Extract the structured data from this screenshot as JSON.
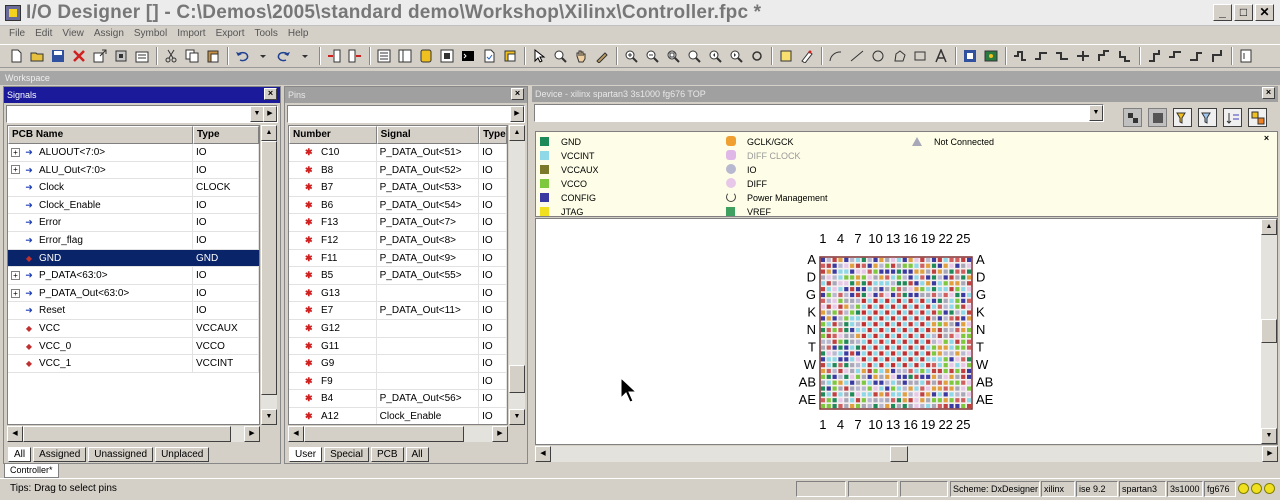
{
  "window": {
    "title": "I/O Designer [] - C:\\Demos\\2005\\standard demo\\Workshop\\Xilinx\\Controller.fpc *",
    "min": "_",
    "max": "□",
    "close": "✕"
  },
  "menu": [
    "File",
    "Edit",
    "View",
    "Assign",
    "Symbol",
    "Import",
    "Export",
    "Tools",
    "Help"
  ],
  "workspace_label": "Workspace",
  "signals": {
    "title": "Signals",
    "columns": [
      "PCB Name",
      "Type"
    ],
    "rows": [
      {
        "name": "ALUOUT<7:0>",
        "type": "IO",
        "expand": "+",
        "icon": "bus-arrow-icon"
      },
      {
        "name": "ALU_Out<7:0>",
        "type": "IO",
        "expand": "+",
        "icon": "bus-arrow-icon"
      },
      {
        "name": "Clock",
        "type": "CLOCK",
        "expand": "",
        "icon": "arrow-icon"
      },
      {
        "name": "Clock_Enable",
        "type": "IO",
        "expand": "",
        "icon": "arrow-icon"
      },
      {
        "name": "Error",
        "type": "IO",
        "expand": "",
        "icon": "arrow-icon"
      },
      {
        "name": "Error_flag",
        "type": "IO",
        "expand": "",
        "icon": "arrow-icon"
      },
      {
        "name": "GND",
        "type": "GND",
        "expand": "",
        "icon": "power-icon",
        "selected": true
      },
      {
        "name": "P_DATA<63:0>",
        "type": "IO",
        "expand": "+",
        "icon": "bus-arrow-icon"
      },
      {
        "name": "P_DATA_Out<63:0>",
        "type": "IO",
        "expand": "+",
        "icon": "bus-arrow-icon"
      },
      {
        "name": "Reset",
        "type": "IO",
        "expand": "",
        "icon": "arrow-icon"
      },
      {
        "name": "VCC",
        "type": "VCCAUX",
        "expand": "",
        "icon": "power-icon"
      },
      {
        "name": "VCC_0",
        "type": "VCCO",
        "expand": "",
        "icon": "power-icon"
      },
      {
        "name": "VCC_1",
        "type": "VCCINT",
        "expand": "",
        "icon": "power-icon"
      }
    ],
    "tabs": [
      "All",
      "Assigned",
      "Unassigned",
      "Unplaced"
    ]
  },
  "pins": {
    "title": "Pins",
    "columns": [
      "Number",
      "Signal",
      "Type"
    ],
    "rows": [
      {
        "num": "C10",
        "signal": "P_DATA_Out<51>",
        "type": "IO"
      },
      {
        "num": "B8",
        "signal": "P_DATA_Out<52>",
        "type": "IO"
      },
      {
        "num": "B7",
        "signal": "P_DATA_Out<53>",
        "type": "IO"
      },
      {
        "num": "B6",
        "signal": "P_DATA_Out<54>",
        "type": "IO"
      },
      {
        "num": "F13",
        "signal": "P_DATA_Out<7>",
        "type": "IO"
      },
      {
        "num": "F12",
        "signal": "P_DATA_Out<8>",
        "type": "IO"
      },
      {
        "num": "F11",
        "signal": "P_DATA_Out<9>",
        "type": "IO"
      },
      {
        "num": "B5",
        "signal": "P_DATA_Out<55>",
        "type": "IO"
      },
      {
        "num": "G13",
        "signal": "",
        "type": "IO"
      },
      {
        "num": "E7",
        "signal": "P_DATA_Out<11>",
        "type": "IO"
      },
      {
        "num": "G12",
        "signal": "",
        "type": "IO"
      },
      {
        "num": "G11",
        "signal": "",
        "type": "IO"
      },
      {
        "num": "G9",
        "signal": "",
        "type": "IO"
      },
      {
        "num": "F9",
        "signal": "",
        "type": "IO"
      },
      {
        "num": "B4",
        "signal": "P_DATA_Out<56>",
        "type": "IO"
      },
      {
        "num": "A12",
        "signal": "Clock_Enable",
        "type": "IO"
      }
    ],
    "tabs": [
      "User",
      "Special",
      "PCB",
      "All"
    ]
  },
  "device": {
    "title": "Device - xilinx   spartan3   3s1000   fg676   TOP",
    "legend": [
      {
        "label": "GND",
        "color": "#1e8a5a",
        "kind": "square"
      },
      {
        "label": "VCCINT",
        "color": "#8ed8e8",
        "kind": "square"
      },
      {
        "label": "VCCAUX",
        "color": "#7a7a2a",
        "kind": "square"
      },
      {
        "label": "VCCO",
        "color": "#7ec840",
        "kind": "square"
      },
      {
        "label": "CONFIG",
        "color": "#3a3aa0",
        "kind": "square"
      },
      {
        "label": "JTAG",
        "color": "#f0e020",
        "kind": "square"
      },
      {
        "label": "GCLK/GCK",
        "color": "#f0a030",
        "kind": "hex"
      },
      {
        "label": "DIFF CLOCK",
        "color": "#e0b8e8",
        "kind": "hex"
      },
      {
        "label": "IO",
        "color": "#b8b8d0",
        "kind": "circle"
      },
      {
        "label": "DIFF",
        "color": "#e8c8e8",
        "kind": "circle"
      },
      {
        "label": "Power Management",
        "color": "#404040",
        "kind": "ring"
      },
      {
        "label": "VREF",
        "color": "#40a060",
        "kind": "square"
      },
      {
        "label": "Not Connected",
        "color": "#a8a8b8",
        "kind": "triangle"
      }
    ],
    "col_labels": [
      "1",
      "4",
      "7",
      "10",
      "13",
      "16",
      "19",
      "22",
      "25"
    ],
    "row_labels": [
      "A",
      "D",
      "G",
      "K",
      "N",
      "T",
      "W",
      "AB",
      "AE"
    ]
  },
  "bottom_tab": "Controller*",
  "status": {
    "tips": "Tips: Drag to select pins",
    "scheme": "Scheme: DxDesigner",
    "vendor": "xilinx",
    "ise": "ise 9.2",
    "family": "spartan3",
    "device": "3s1000",
    "package": "fg676"
  }
}
